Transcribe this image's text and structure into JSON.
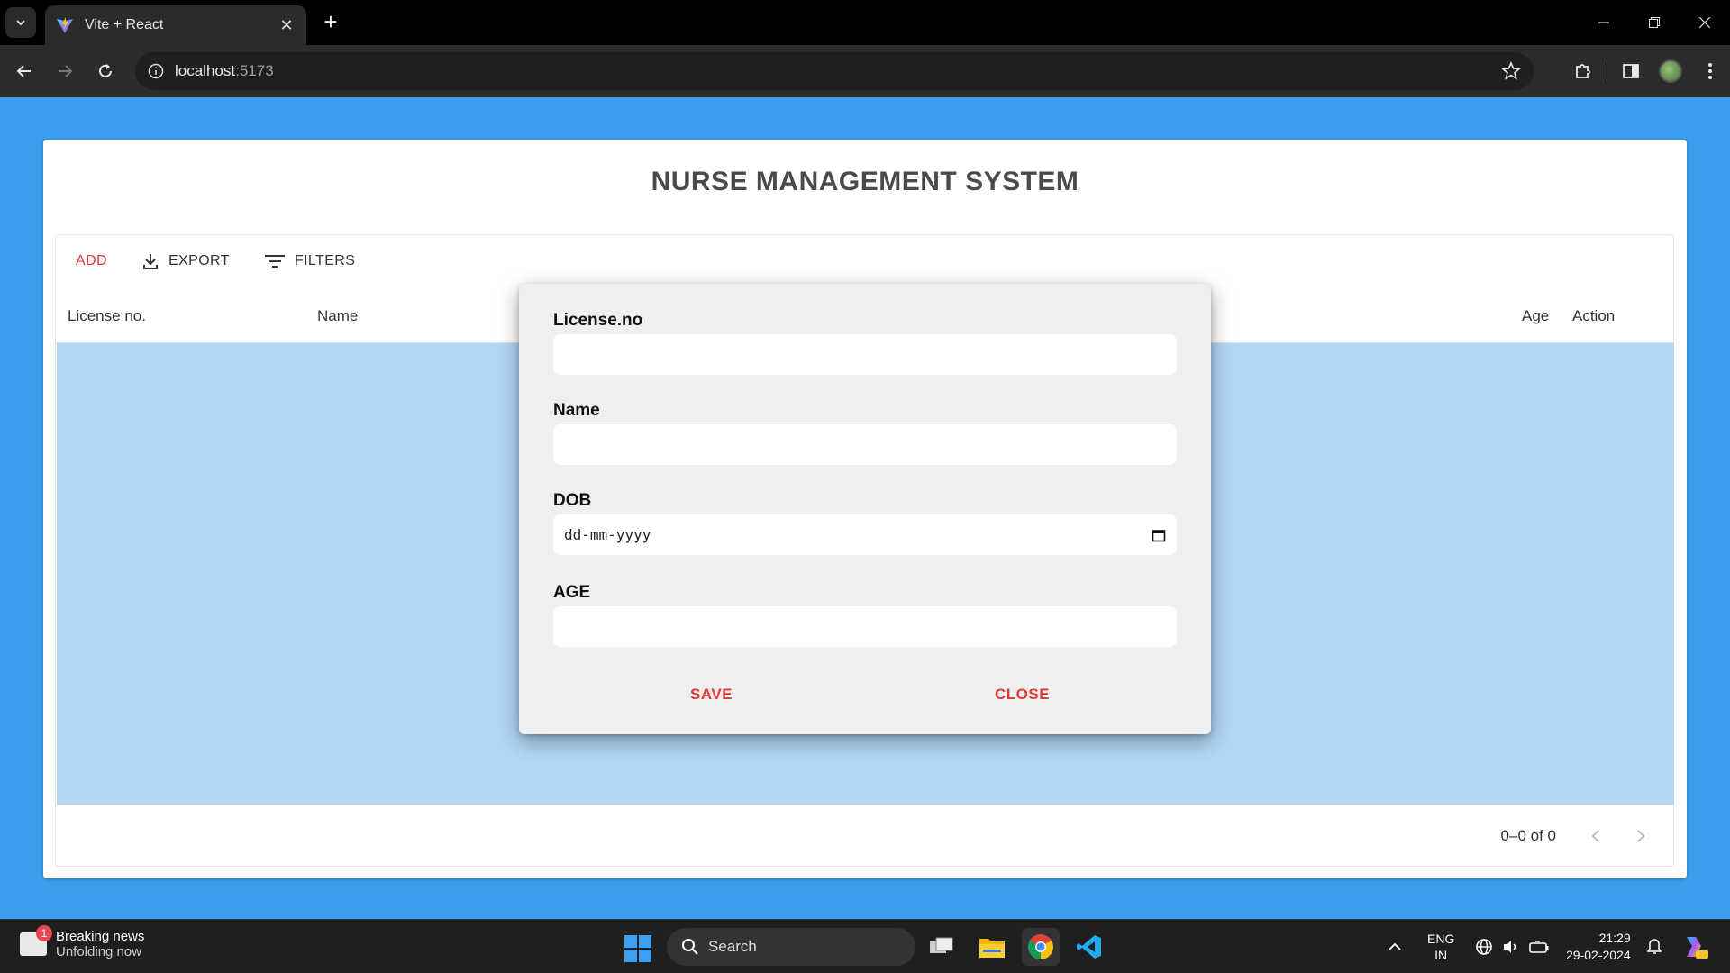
{
  "browser": {
    "tab_title": "Vite + React",
    "url_host": "localhost",
    "url_port": ":5173"
  },
  "app": {
    "title": "NURSE MANAGEMENT SYSTEM",
    "toolbar": {
      "add_label": "ADD",
      "export_label": "EXPORT",
      "filters_label": "FILTERS"
    },
    "columns": [
      "License no.",
      "Name",
      "Age",
      "Action"
    ],
    "pagination": "0–0 of 0"
  },
  "modal": {
    "license_label": "License.no",
    "name_label": "Name",
    "dob_label": "DOB",
    "dob_placeholder": "dd-mm-yyyy",
    "age_label": "AGE",
    "save_label": "SAVE",
    "close_label": "CLOSE"
  },
  "taskbar": {
    "news_badge": "1",
    "news_title": "Breaking news",
    "news_subtitle": "Unfolding now",
    "search_label": "Search",
    "lang_line1": "ENG",
    "lang_line2": "IN",
    "time": "21:29",
    "date": "29-02-2024"
  },
  "colors": {
    "page_background": "#3d9ef0",
    "accent_red": "#e53935",
    "grid_body": "#b2d7f7",
    "modal_background": "#efefef"
  }
}
